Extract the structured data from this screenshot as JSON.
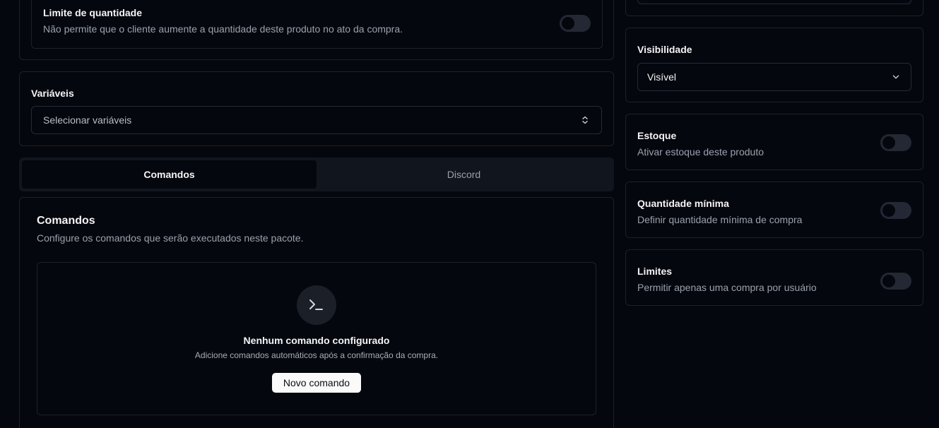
{
  "left": {
    "quantity_limit": {
      "title": "Limite de quantidade",
      "description": "Não permite que o cliente aumente a quantidade deste produto no ato da compra."
    },
    "variables": {
      "label": "Variáveis",
      "placeholder": "Selecionar variáveis"
    },
    "tabs": [
      {
        "label": "Comandos",
        "active": true
      },
      {
        "label": "Discord",
        "active": false
      }
    ],
    "commands": {
      "title": "Comandos",
      "description": "Configure os comandos que serão executados neste pacote.",
      "empty_title": "Nenhum comando configurado",
      "empty_description": "Adicione comandos automáticos após a confirmação da compra.",
      "new_button": "Novo comando",
      "icon": "terminal-icon"
    }
  },
  "right": {
    "visibility": {
      "label": "Visibilidade",
      "value": "Visível"
    },
    "stock": {
      "title": "Estoque",
      "description": "Ativar estoque deste produto"
    },
    "min_quantity": {
      "title": "Quantidade mínima",
      "description": "Definir quantidade mínima de compra"
    },
    "limits": {
      "title": "Limites",
      "description": "Permitir apenas uma compra por usuário"
    }
  },
  "colors": {
    "background": "#05070e",
    "border": "#1c212c",
    "muted_text": "#9aa1ad",
    "toggle_off": "#232834"
  }
}
